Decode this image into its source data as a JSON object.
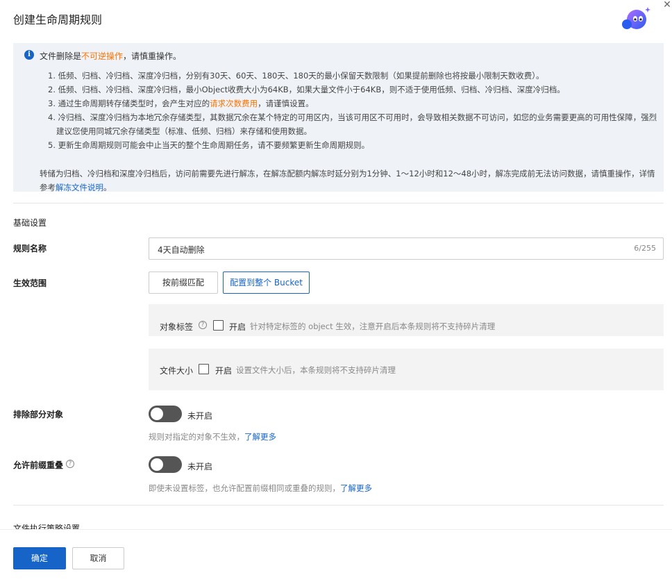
{
  "dialog": {
    "title": "创建生命周期规则",
    "close_icon": "close-icon",
    "mascot_icon": "assistant-mascot-icon"
  },
  "notice": {
    "icon": "info-icon",
    "intro_prefix": "文件删除是",
    "intro_highlight": "不可逆操作",
    "intro_suffix": "，请慎重操作。",
    "items": [
      "1. 低频、归档、冷归档、深度冷归档，分别有30天、60天、180天、180天的最小保留天数限制（如果提前删除也将按最小限制天数收费）。",
      "2. 低频、归档、冷归档、深度冷归档，最小Object收费大小为64KB，如果大量文件小于64KB，则不适于使用低频、归档、冷归档、深度冷归档。",
      "4. 冷归档、深度冷归档为本地冗余存储类型，其数据冗余在某个特定的可用区内，当该可用区不可用时，会导致相关数据不可访问，如您的业务需要更高的可用性保障，强烈建议您使用同城冗余存储类型（标准、低频、归档）来存储和使用数据。",
      "5. 更新生命周期规则可能会中止当天的整个生命周期任务，请不要频繁更新生命周期规则。"
    ],
    "item3_prefix": "3. 通过生命周期转存储类型时，会产生对应的",
    "item3_highlight": "请求次数费用",
    "item3_suffix": "，请谨慎设置。",
    "tail_text": "转储为归档、冷归档和深度冷归档后，访问前需要先进行解冻，在解冻配额内解冻时延分别为1分钟、1～12小时和12～48小时，解冻完成前无法访问数据，请慎重操作，详情参考",
    "tail_link": "解冻文件说明",
    "tail_end": "。"
  },
  "basic": {
    "section_title": "基础设置",
    "rule_name_label": "规则名称",
    "rule_name_value": "4天自动删除",
    "rule_name_count": "6/255",
    "scope_label": "生效范围",
    "scope_options": [
      "按前缀匹配",
      "配置到整个 Bucket"
    ],
    "scope_selected": "配置到整个 Bucket",
    "tag_label": "对象标签",
    "tag_help_icon": "help-circle-icon",
    "tag_check_label": "开启",
    "tag_hint": "针对特定标签的 object 生效，注意开启后本条规则将不支持碎片清理",
    "size_label": "文件大小",
    "size_check_label": "开启",
    "size_hint": "设置文件大小后，本条规则将不支持碎片清理",
    "exclude_label": "排除部分对象",
    "exclude_state": "未开启",
    "exclude_hint": "规则对指定的对象不生效，",
    "exclude_link": "了解更多",
    "overlap_label": "允许前缀重叠",
    "overlap_help_icon": "help-circle-icon",
    "overlap_state": "未开启",
    "overlap_hint": "即使未设置标签，也允许配置前缀相同或重叠的规则，",
    "overlap_link": "了解更多",
    "next_section_title": "文件执行策略设置"
  },
  "footer": {
    "ok_label": "确定",
    "cancel_label": "取消"
  },
  "colors": {
    "primary": "#1664c8",
    "warning": "#ff7200",
    "notice_bg": "#eff3f8"
  }
}
